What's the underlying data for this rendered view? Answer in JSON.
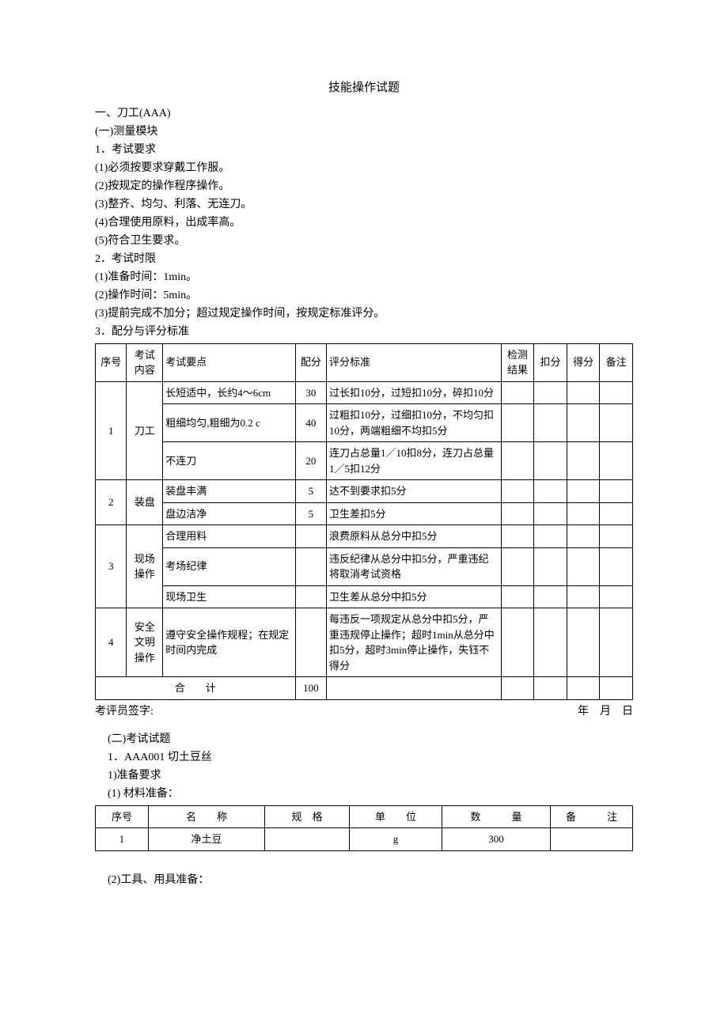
{
  "title": "技能操作试题",
  "section1": {
    "header": "一、刀工(AAA)",
    "sub1": "(一)测量模块",
    "req_header": "1．考试要求",
    "reqs": [
      "(1)必须按要求穿戴工作服。",
      "(2)按规定的操作程序操作。",
      "(3)整齐、均匀、利落、无连刀。",
      "(4)合理使用原料，出成率高。",
      "(5)符合卫生要求。"
    ],
    "time_header": "2．考试时限",
    "times": [
      "(1)准备时间：1min。",
      "(2)操作时间：5min。",
      "(3)提前完成不加分；超过规定操作时间，按规定标准评分。"
    ],
    "scoring_header": "3．配分与评分标准"
  },
  "score_table": {
    "headers": {
      "num": "序号",
      "content": "考试内容",
      "points": "考试要点",
      "score": "配分",
      "std": "评分标准",
      "result": "检测结果",
      "deduct": "扣分",
      "got": "得分",
      "remark": "备注"
    },
    "rows": [
      {
        "num": "1",
        "content": "刀工",
        "items": [
          {
            "point": "长短适中，长约4～6cm",
            "score": "30",
            "std": "过长扣10分，过短扣10分，碎扣10分"
          },
          {
            "point": "粗细均匀,粗细为0.2 c",
            "score": "40",
            "std": "过粗扣10分，过细扣10分，不均匀扣10分，两端粗细不均扣5分"
          },
          {
            "point": "不连刀",
            "score": "20",
            "std": "连刀占总量1／10扣8分，连刀占总量1／5扣12分"
          }
        ]
      },
      {
        "num": "2",
        "content": "装盘",
        "items": [
          {
            "point": "装盘丰满",
            "score": "5",
            "std": "达不到要求扣5分"
          },
          {
            "point": "盘边洁净",
            "score": "5",
            "std": "卫生差扣5分"
          }
        ]
      },
      {
        "num": "3",
        "content": "现场操作",
        "items": [
          {
            "point": "合理用料",
            "score": "",
            "std": "浪费原料从总分中扣5分"
          },
          {
            "point": "考场纪律",
            "score": "",
            "std": "违反纪律从总分中扣5分，严重违纪将取消考试资格"
          },
          {
            "point": "现场卫生",
            "score": "",
            "std": "卫生差从总分中扣5分"
          }
        ]
      },
      {
        "num": "4",
        "content": "安全文明操作",
        "items": [
          {
            "point": "遵守安全操作规程；在规定时间内完成",
            "score": "",
            "std": "每违反一项规定从总分中扣5分，严重违规停止操作；超时1min从总分中扣5分，超时3min停止操作，失钰不得分"
          }
        ]
      }
    ],
    "total_label": "合　　计",
    "total_score": "100"
  },
  "signature": {
    "left": "考评员签字:",
    "right": "年　月　日"
  },
  "section2": {
    "header": "(二)考试试题",
    "item1": "1．AAA001 切土豆丝",
    "prep": "1)准备要求",
    "material_header": "(1) 材料准备："
  },
  "material_table": {
    "headers": {
      "num": "序号",
      "name": "名　　称",
      "spec": "规　格",
      "unit": "单　　位",
      "qty": "数　　　量",
      "remark": "备　　　注"
    },
    "row": {
      "num": "1",
      "name": "净土豆",
      "spec": "",
      "unit": "g",
      "qty": "300",
      "remark": ""
    }
  },
  "tools_header": "(2)工具、用具准备："
}
